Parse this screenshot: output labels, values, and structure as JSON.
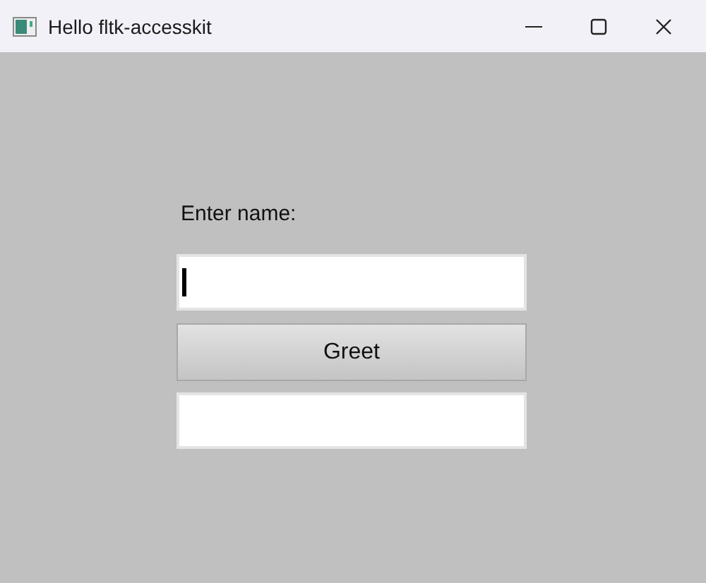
{
  "window": {
    "title": "Hello fltk-accesskit"
  },
  "label": "Enter name:",
  "name_input": {
    "focused": true
  },
  "greet_button": {
    "label": "Greet"
  }
}
